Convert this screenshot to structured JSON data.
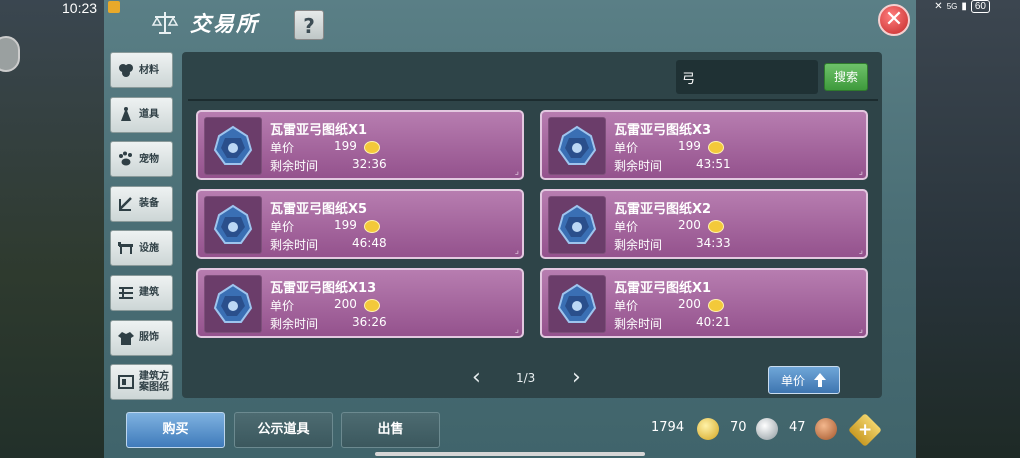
{
  "status_bar": {
    "time": "10:23",
    "network": "5G",
    "battery": "60"
  },
  "window": {
    "title": "交易所",
    "help_label": "?",
    "close_label": "✕"
  },
  "categories": [
    {
      "label": "材料",
      "icon": "materials-icon"
    },
    {
      "label": "道具",
      "icon": "props-icon"
    },
    {
      "label": "宠物",
      "icon": "pet-paw-icon"
    },
    {
      "label": "装备",
      "icon": "equipment-icon"
    },
    {
      "label": "设施",
      "icon": "facility-icon"
    },
    {
      "label": "建筑",
      "icon": "building-icon"
    },
    {
      "label": "服饰",
      "icon": "clothing-icon"
    },
    {
      "label": "建筑方案图纸",
      "icon": "blueprint-icon"
    }
  ],
  "search": {
    "value": "弓",
    "button_label": "搜索"
  },
  "listings": [
    {
      "name": "瓦雷亚弓图纸X1",
      "price_label": "单价",
      "price": "199",
      "time_label": "剩余时间",
      "time": "32:36"
    },
    {
      "name": "瓦雷亚弓图纸X3",
      "price_label": "单价",
      "price": "199",
      "time_label": "剩余时间",
      "time": "43:51"
    },
    {
      "name": "瓦雷亚弓图纸X5",
      "price_label": "单价",
      "price": "199",
      "time_label": "剩余时间",
      "time": "46:48"
    },
    {
      "name": "瓦雷亚弓图纸X2",
      "price_label": "单价",
      "price": "200",
      "time_label": "剩余时间",
      "time": "34:33"
    },
    {
      "name": "瓦雷亚弓图纸X13",
      "price_label": "单价",
      "price": "200",
      "time_label": "剩余时间",
      "time": "36:26"
    },
    {
      "name": "瓦雷亚弓图纸X1",
      "price_label": "单价",
      "price": "200",
      "time_label": "剩余时间",
      "time": "40:21"
    }
  ],
  "pagination": {
    "page_text": "1/3"
  },
  "sort_button": {
    "label": "单价"
  },
  "bottom_tabs": [
    {
      "label": "购买",
      "active": true
    },
    {
      "label": "公示道具",
      "active": false
    },
    {
      "label": "出售",
      "active": false
    }
  ],
  "currencies": [
    {
      "value": "1794",
      "icon": "gold-coin-icon",
      "color": "#e8c23a"
    },
    {
      "value": "70",
      "icon": "silver-coin-icon",
      "color": "#c9d1d6"
    },
    {
      "value": "47",
      "icon": "copper-coin-icon",
      "color": "#c8784a"
    }
  ],
  "colors": {
    "card_bg": "#a868a0",
    "card_border": "#e3c8e0",
    "panel_bg": "#2e4448",
    "window_bg": "#52767d",
    "active_tab": "#5a95cd",
    "search_btn": "#55ae52",
    "close_btn": "#d83a3a"
  }
}
